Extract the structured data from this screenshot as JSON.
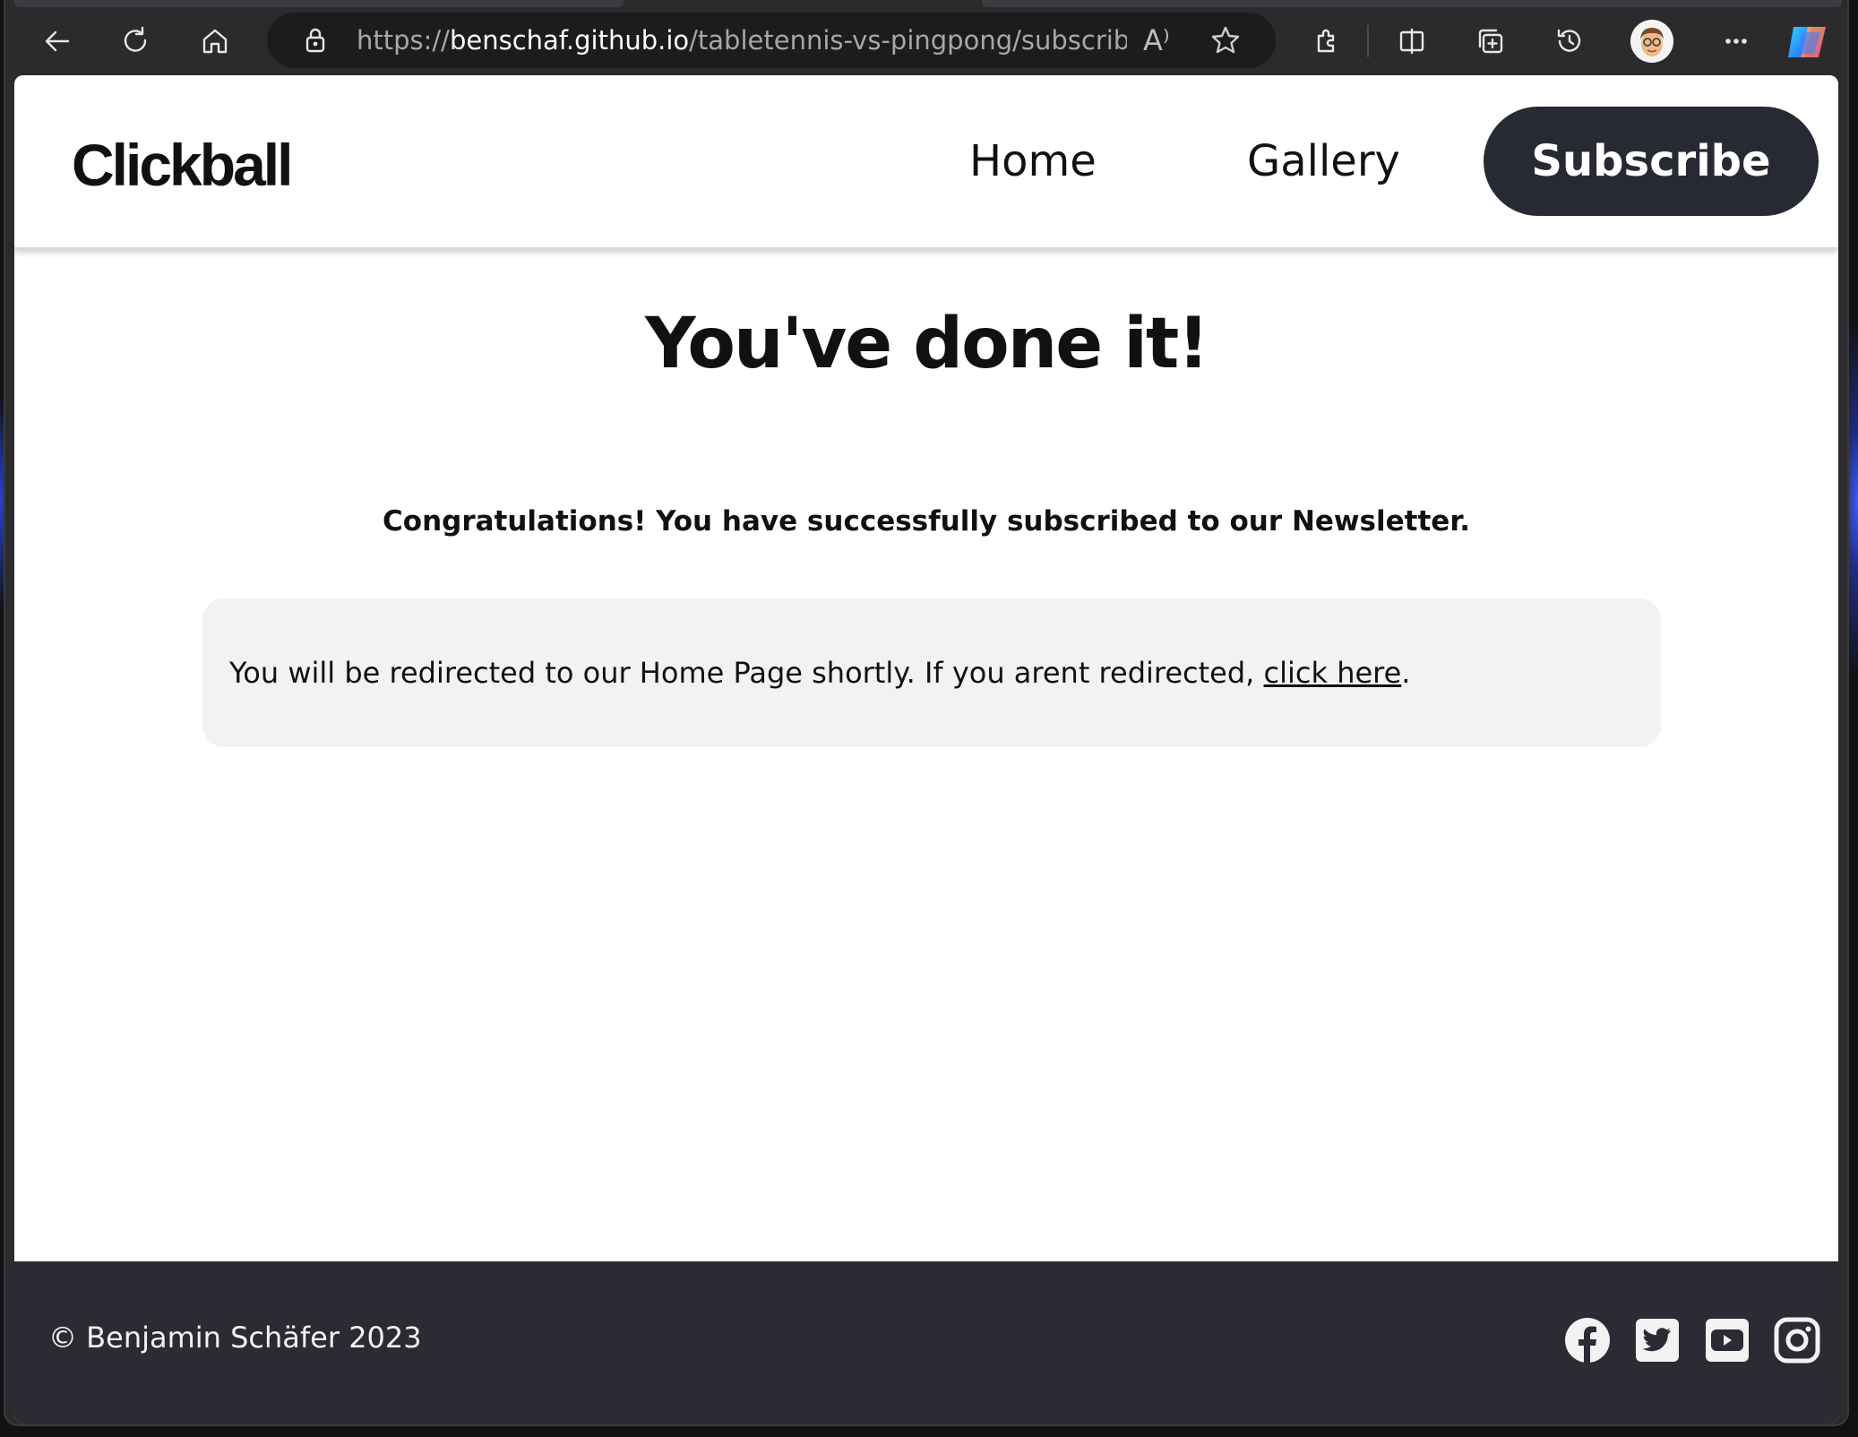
{
  "browser": {
    "url_scheme": "https://",
    "url_host": "benschaf.github.io",
    "url_path": "/tabletennis-vs-pingpong/subscribed...",
    "read_aloud_label": "A⁾",
    "icons": [
      "back-arrow-icon",
      "refresh-icon",
      "home-icon",
      "lock-icon",
      "read-aloud-icon",
      "favorite-star-icon",
      "extensions-icon",
      "split-screen-icon",
      "collections-icon",
      "history-icon",
      "profile-avatar",
      "more-icon",
      "copilot-icon"
    ]
  },
  "site": {
    "logo": "Clickball",
    "nav": {
      "home": "Home",
      "gallery": "Gallery",
      "subscribe": "Subscribe"
    },
    "title": "You've done it!",
    "congrats": "Congratulations! You have successfully subscribed to our Newsletter.",
    "notice": {
      "text_before": "You will be redirected to our Home Page shortly. If you arent redirected, ",
      "link": "click here",
      "text_after": "."
    },
    "footer": {
      "copyright": "© Benjamin Schäfer 2023",
      "social": [
        "facebook-icon",
        "twitter-icon",
        "youtube-icon",
        "instagram-icon"
      ]
    }
  },
  "colors": {
    "dark": "#282a33",
    "footer_bg": "#2a2b33",
    "notice_bg": "#f2f2f2",
    "browser_chrome": "#2b2b2e"
  }
}
